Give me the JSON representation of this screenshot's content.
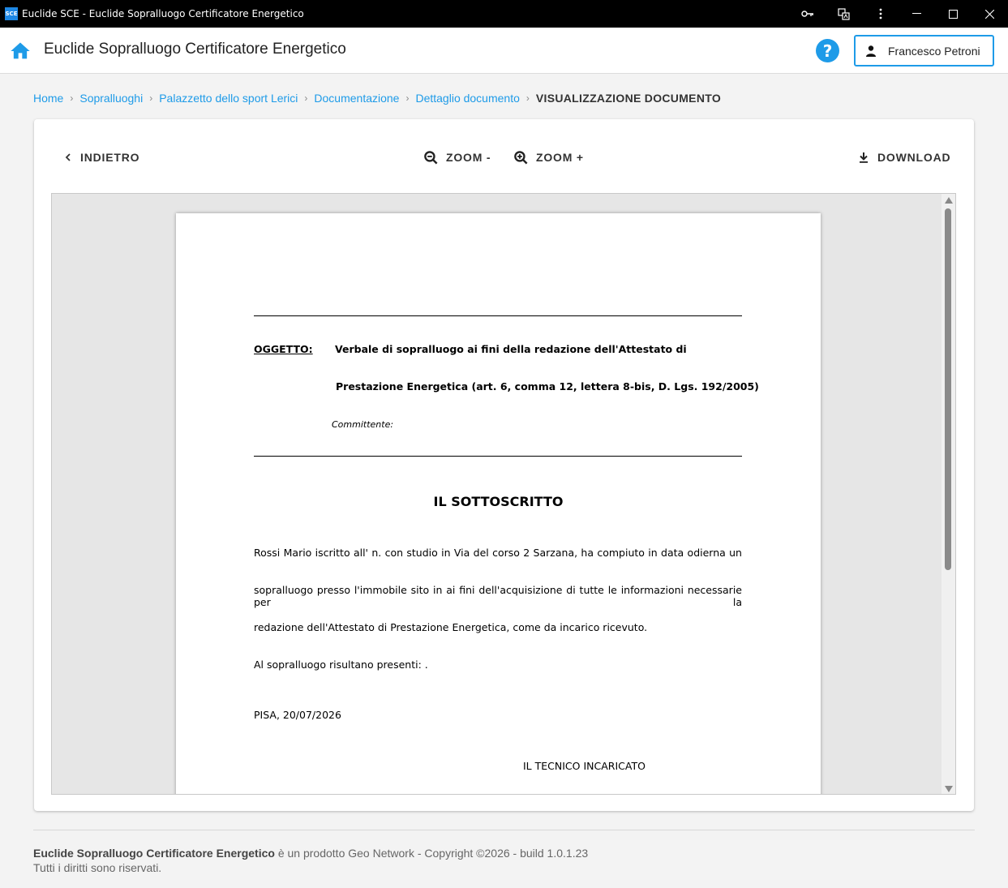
{
  "window": {
    "icon_label": "SCE",
    "title": "Euclide SCE - Euclide Sopralluogo Certificatore Energetico"
  },
  "appbar": {
    "title": "Euclide Sopralluogo Certificatore Energetico",
    "help_label": "?",
    "user_name": "Francesco Petroni",
    "accent_color": "#1e9be8"
  },
  "breadcrumb": {
    "items": [
      "Home",
      "Sopralluoghi",
      "Palazzetto dello sport Lerici",
      "Documentazione",
      "Dettaglio documento"
    ],
    "separator": "›",
    "current": "VISUALIZZAZIONE DOCUMENTO"
  },
  "toolbar": {
    "back_label": "INDIETRO",
    "zoom_out_label": "ZOOM -",
    "zoom_in_label": "ZOOM +",
    "download_label": "DOWNLOAD"
  },
  "document": {
    "subject_label": "OGGETTO:",
    "subject_line1": "Verbale di sopralluogo ai fini della redazione dell'Attestato di",
    "subject_line2": "Prestazione Energetica (art. 6, comma 12, lettera 8-bis, D. Lgs. 192/2005)",
    "client_label": "Committente:",
    "heading": "IL SOTTOSCRITTO",
    "para_line1": "Rossi Mario iscritto all' n. con studio in Via del corso 2 Sarzana, ha compiuto in data odierna un",
    "para_line2": "sopralluogo presso l'immobile sito in  ai fini dell'acquisizione di tutte le informazioni necessarie per la",
    "para_line3": "redazione dell'Attestato di Prestazione Energetica, come da incarico ricevuto.",
    "present_line": "Al sopralluogo risultano presenti: .",
    "place_date": "PISA, 20/07/2026",
    "signature_label": "IL TECNICO INCARICATO"
  },
  "footer": {
    "product": "Euclide Sopralluogo Certificatore Energetico",
    "copyright": " è un prodotto Geo Network - Copyright ©2026 - build 1.0.1.23",
    "rights": "Tutti i diritti sono riservati."
  }
}
